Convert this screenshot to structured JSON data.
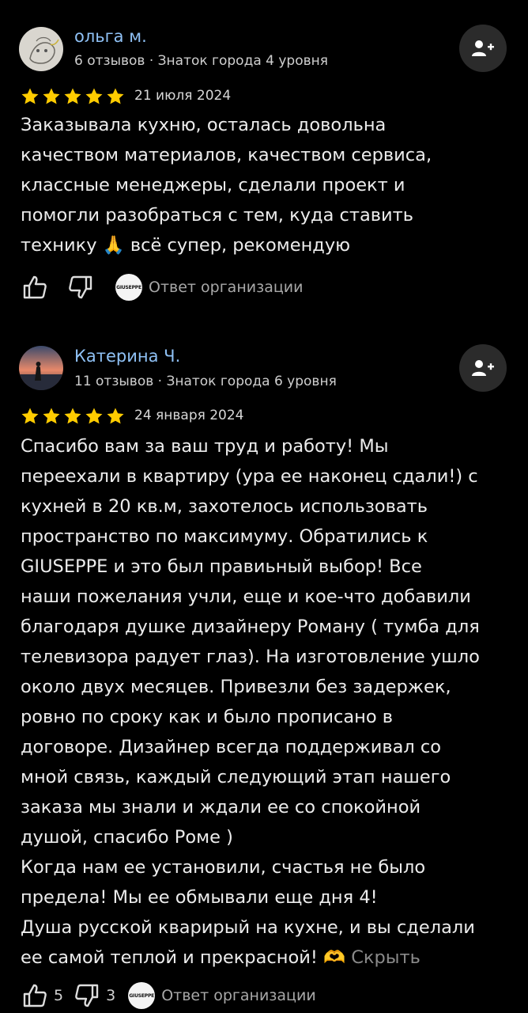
{
  "reviews": [
    {
      "author": "ольга м.",
      "meta": "6 отзывов · Знаток города 4 уровня",
      "rating": 5,
      "date": "21 июля 2024",
      "text_lines": [
        "Заказывала кухню, осталась довольна",
        "качеством материалов, качеством сервиса,",
        "классные менеджеры, сделали проект и",
        "помогли разобраться с тем, куда ставить",
        "технику 🙏 всё супер, рекомендую"
      ],
      "likes": "",
      "dislikes": "",
      "org_logo_text": "GIUSEPPE",
      "org_reply_label": "Ответ организации"
    },
    {
      "author": "Катерина Ч.",
      "meta": "11 отзывов · Знаток города 6 уровня",
      "rating": 5,
      "date": "24 января 2024",
      "text_lines": [
        "Спасибо вам за ваш труд и работу! Мы",
        "переехали в квартиру (ура ее наконец сдали!) с",
        "кухней в 20 кв.м, захотелось использовать",
        "пространство по максимуму. Обратились к",
        "GIUSEPPE и это был правиьный выбор! Все",
        "наши пожелания учли, еще и кое-что добавили",
        "благодаря душке дизайнеру Роману ( тумба для",
        "телевизора радует глаз). На изготовление ушло",
        "около двух месяцев. Привезли без задержек,",
        "ровно по сроку как и было прописано в",
        "договоре. Дизайнер всегда поддерживал со",
        "мной связь, каждый следующий этап нашего",
        "заказа мы знали и ждали ее со спокойной",
        "душой, спасибо Роме )",
        "Когда нам ее установили, счастья не было",
        "предела! Мы ее обмывали еще дня 4!",
        "Душа русской кварирый на кухне, и вы сделали",
        "ее самой теплой и прекрасной! 🫶"
      ],
      "hide_label": "Скрыть",
      "likes": "5",
      "dislikes": "3",
      "org_logo_text": "GIUSEPPE",
      "org_reply_label": "Ответ организации"
    }
  ],
  "colors": {
    "background": "#000000",
    "author_name": "#8fc1f5",
    "star": "#ffcc00",
    "follow_button_bg": "#2b2b2b"
  },
  "icons": [
    "user-plus-icon",
    "star-icon",
    "thumbs-up-icon",
    "thumbs-down-icon"
  ]
}
